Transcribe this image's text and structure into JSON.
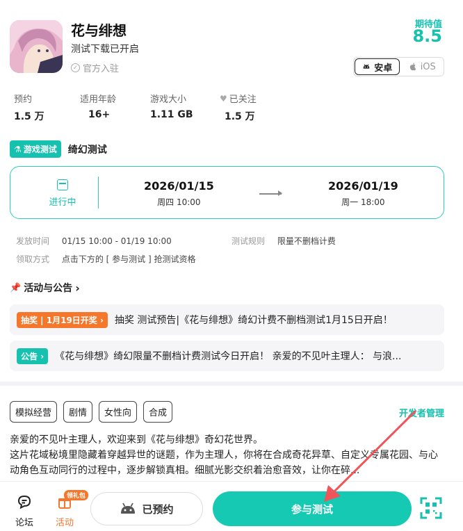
{
  "header": {
    "title": "花与绯想",
    "subtitle": "测试下载已开启",
    "official": "官方入驻",
    "expect_label": "期待值",
    "expect_value": "8.5",
    "platforms": [
      "安卓",
      "iOS"
    ]
  },
  "stats": [
    {
      "label": "预约",
      "value": "1.5 万"
    },
    {
      "label": "适用年龄",
      "value": "16+"
    },
    {
      "label": "游戏大小",
      "value": "1.11 GB"
    },
    {
      "label": "已关注",
      "value": "1.5 万"
    }
  ],
  "test": {
    "badge": "游戏测试",
    "name": "绮幻测试",
    "status": "进行中",
    "start_date": "2026/01/15",
    "start_time": "周四 10:00",
    "end_date": "2026/01/19",
    "end_time": "周一 18:00",
    "release_label": "发放时间",
    "release_value": "01/15 10:00 - 01/19 10:00",
    "rule_label": "测试规则",
    "rule_value": "限量不删档计费",
    "claim_label": "领取方式",
    "claim_value": "点击下方的 [ 参与测试 ] 抢测试资格"
  },
  "activities": {
    "title": "活动与公告",
    "items": [
      {
        "tag": "抽奖 | 1月19日开奖",
        "text": "抽奖 测试预告|《花与绯想》绮幻计费不删档测试1月15日开启！"
      },
      {
        "tag": "公告",
        "text": "《花与绯想》绮幻限量不删档计费测试今日开启！ 亲爱的不见叶主理人： 与浪..."
      }
    ]
  },
  "tags": [
    "模拟经营",
    "剧情",
    "女性向",
    "合成"
  ],
  "developer_link": "开发者管理",
  "description": {
    "line1": "亲爱的不见叶主理人，欢迎来到《花与绯想》奇幻花世界。",
    "line2": "这片花域秘境里隐藏着穿越异世的谜题，作为主理人，你将在合成奇花异草、自定义专属花园、与心动角色互动同行的过程中，逐步解锁真相。细腻光影交织着治愈音效，让你在碎..."
  },
  "bottom_bar": {
    "forum": "论坛",
    "activity": "活动",
    "gift_badge": "领礼包",
    "reserved": "已预约",
    "join": "参与测试"
  },
  "colors": {
    "accent": "#16c1b0",
    "orange": "#f5772c",
    "arrow": "#f0555a"
  }
}
